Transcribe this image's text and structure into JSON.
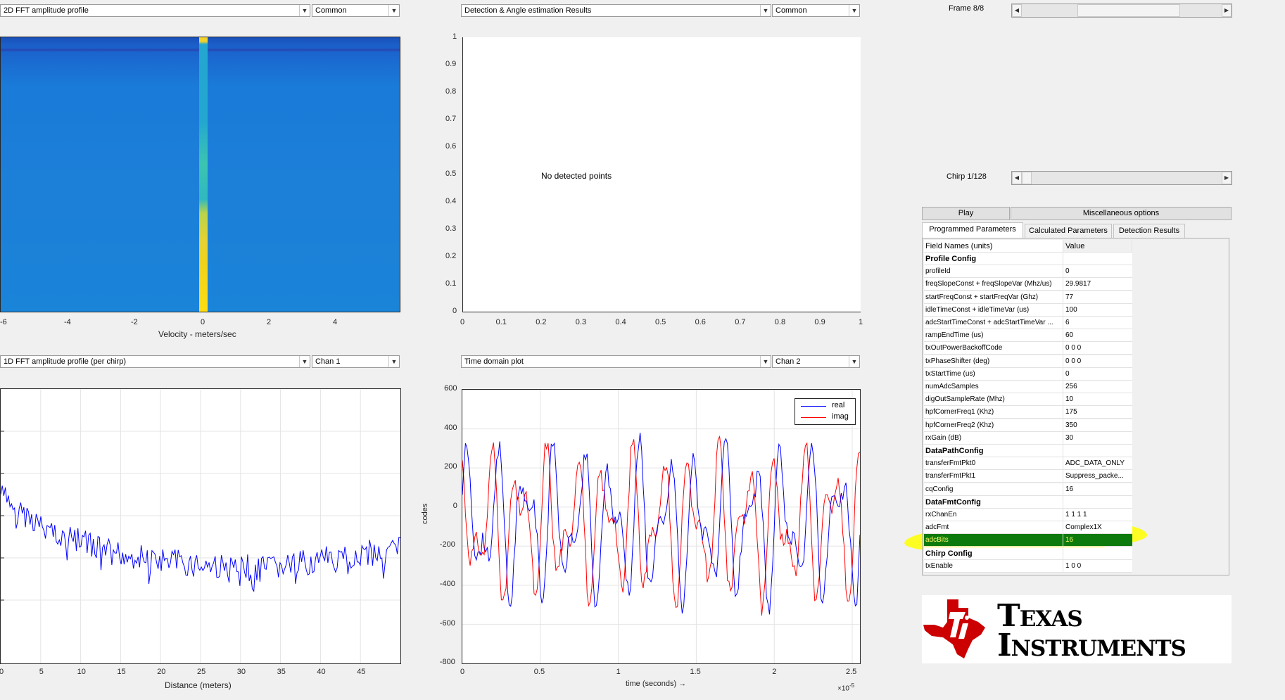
{
  "top_left_panel": {
    "plot_select": "2D FFT amplitude profile",
    "mode_select": "Common",
    "xticks": [
      "-6",
      "-4",
      "-2",
      "0",
      "2",
      "4"
    ],
    "xlabel": "Velocity - meters/sec"
  },
  "top_mid_panel": {
    "plot_select": "Detection & Angle estimation Results",
    "mode_select": "Common",
    "message": "No detected points",
    "yticks": [
      "1",
      "0.9",
      "0.8",
      "0.7",
      "0.6",
      "0.5",
      "0.4",
      "0.3",
      "0.2",
      "0.1",
      "0"
    ],
    "xticks": [
      "0",
      "0.1",
      "0.2",
      "0.3",
      "0.4",
      "0.5",
      "0.6",
      "0.7",
      "0.8",
      "0.9",
      "1"
    ]
  },
  "bottom_left_panel": {
    "plot_select": "1D FFT amplitude profile (per chirp)",
    "channel_select": "Chan 1",
    "xticks": [
      "0",
      "5",
      "10",
      "15",
      "20",
      "25",
      "30",
      "35",
      "40",
      "45"
    ],
    "xlabel": "Distance (meters)"
  },
  "bottom_mid_panel": {
    "plot_select": "Time domain plot",
    "channel_select": "Chan 2",
    "yticks": [
      "600",
      "400",
      "200",
      "0",
      "-200",
      "-400",
      "-600",
      "-800"
    ],
    "xticks": [
      "0",
      "0.5",
      "1",
      "1.5",
      "2",
      "2.5"
    ],
    "ylabel": "codes",
    "xlabel": "time  (seconds) →",
    "exponent_base": "×10",
    "exponent_power": "-5",
    "legend": [
      "real",
      "imag"
    ]
  },
  "controls": {
    "frame_label": "Frame 8/8",
    "frame_position": 0.5,
    "chirp_label": "Chirp 1/128",
    "chirp_position": 0.0,
    "play_label": "Play",
    "misc_label": "Miscellaneous options",
    "tabs": [
      "Programmed Parameters",
      "Calculated Parameters",
      "Detection Results"
    ],
    "table_headers": [
      "Field Names    (units)",
      "Value"
    ],
    "rows": [
      {
        "name": "Profile Config",
        "value": "",
        "section": true
      },
      {
        "name": "profileId",
        "value": "0"
      },
      {
        "name": "freqSlopeConst + freqSlopeVar (Mhz/us)",
        "value": "29.9817"
      },
      {
        "name": "startFreqConst + startFreqVar (Ghz)",
        "value": "77"
      },
      {
        "name": "idleTimeConst + idleTimeVar (us)",
        "value": "100"
      },
      {
        "name": "adcStartTimeConst + adcStartTimeVar ...",
        "value": "6"
      },
      {
        "name": "rampEndTime (us)",
        "value": "60"
      },
      {
        "name": "txOutPowerBackoffCode",
        "value": "0 0 0"
      },
      {
        "name": "txPhaseShifter (deg)",
        "value": "0 0 0"
      },
      {
        "name": "txStartTime (us)",
        "value": "0"
      },
      {
        "name": "numAdcSamples",
        "value": "256"
      },
      {
        "name": "digOutSampleRate (Mhz)",
        "value": "10"
      },
      {
        "name": "hpfCornerFreq1 (Khz)",
        "value": "175"
      },
      {
        "name": "hpfCornerFreq2 (Khz)",
        "value": "350"
      },
      {
        "name": "rxGain (dB)",
        "value": "30"
      },
      {
        "name": "DataPathConfig",
        "value": "",
        "section": true
      },
      {
        "name": "transferFmtPkt0",
        "value": "ADC_DATA_ONLY"
      },
      {
        "name": "transferFmtPkt1",
        "value": "Suppress_packe..."
      },
      {
        "name": "cqConfig",
        "value": "16"
      },
      {
        "name": "DataFmtConfig",
        "value": "",
        "section": true
      },
      {
        "name": "rxChanEn",
        "value": "1 1 1 1"
      },
      {
        "name": "adcFmt",
        "value": "Complex1X"
      },
      {
        "name": "adcBits",
        "value": "16",
        "highlight": true
      },
      {
        "name": "Chirp Config",
        "value": "",
        "section": true
      },
      {
        "name": "txEnable",
        "value": "1 0 0"
      }
    ]
  },
  "logo": {
    "line1": "Texas",
    "line2": "Instruments",
    "brand_color": "#cc0000"
  },
  "colors": {
    "real": "#0000ff",
    "imag": "#ff0000",
    "highlight_marker": "#ffff00",
    "heatmap_base": "#1a7fd6",
    "heatmap_hot": "#ffd21f"
  }
}
